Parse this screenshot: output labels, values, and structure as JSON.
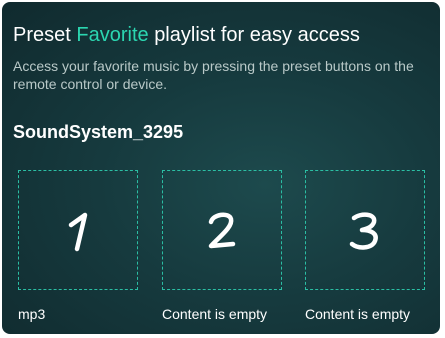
{
  "header": {
    "title_prefix": "Preset",
    "title_accent": "Favorite",
    "title_suffix": "playlist for easy access",
    "description": "Access your favorite music by pressing the preset buttons on the remote control or device."
  },
  "device": {
    "name": "SoundSystem_3295"
  },
  "presets": [
    {
      "number": "1",
      "label": "mp3"
    },
    {
      "number": "2",
      "label": "Content is empty"
    },
    {
      "number": "3",
      "label": "Content is empty"
    }
  ],
  "colors": {
    "accent": "#2bd6b0",
    "background": "#163a3e",
    "dashed_border": "#2bbfa4"
  }
}
